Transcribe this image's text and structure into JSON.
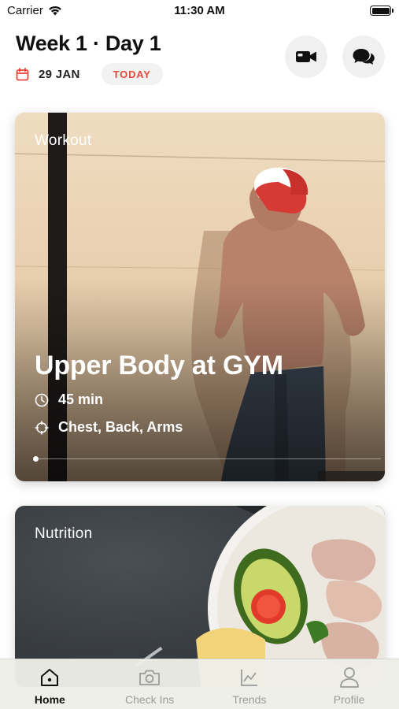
{
  "status_bar": {
    "carrier": "Carrier",
    "time": "11:30 AM"
  },
  "header": {
    "title": "Week 1 · Day 1",
    "date": "29 JAN",
    "today_badge": "TODAY",
    "calendar_icon": "calendar-icon",
    "video_icon": "video-camera-icon",
    "chat_icon": "chat-bubbles-icon",
    "accent_color": "#e5483c"
  },
  "workout": {
    "label": "Workout",
    "title": "Upper Body at GYM",
    "duration": "45 min",
    "muscles": "Chest, Back, Arms",
    "duration_icon": "clock-icon",
    "muscles_icon": "crosshair-icon"
  },
  "nutrition": {
    "label": "Nutrition"
  },
  "tab_bar": {
    "active": "Home",
    "tabs": [
      {
        "label": "Home",
        "icon": "home-icon"
      },
      {
        "label": "Check Ins",
        "icon": "camera-icon"
      },
      {
        "label": "Trends",
        "icon": "chart-icon"
      },
      {
        "label": "Profile",
        "icon": "user-icon"
      }
    ]
  }
}
